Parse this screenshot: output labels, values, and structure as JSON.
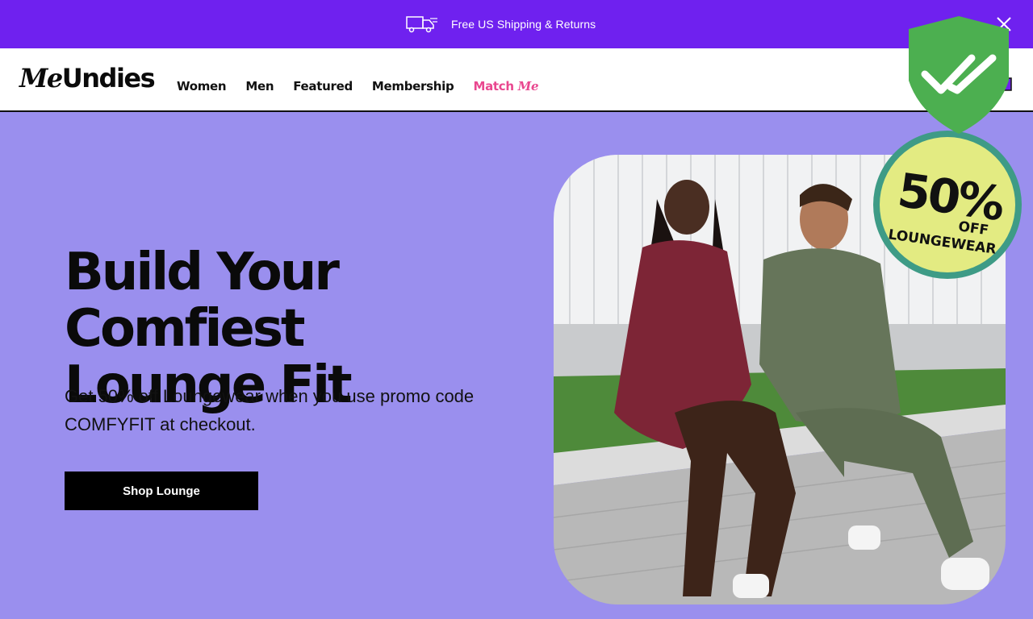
{
  "promo": {
    "text": "Free US Shipping & Returns",
    "truck_icon": "truck-icon",
    "close_icon": "close-icon"
  },
  "header": {
    "logo_me": "Me",
    "logo_rest": "Undies",
    "nav": [
      {
        "label": "Women"
      },
      {
        "label": "Men"
      },
      {
        "label": "Featured"
      },
      {
        "label": "Membership"
      }
    ],
    "match_label_a": "Match ",
    "match_label_b": "Me",
    "cart_icon": "shopping-bag-icon"
  },
  "hero": {
    "title_line1": "Build Your Comfiest",
    "title_line2": "Lounge Fit",
    "subtitle": "Get 50% off Loungewear when you use promo code COMFYFIT at checkout.",
    "cta_label": "Shop Lounge",
    "image": "Two people in loungewear sitting on a concrete ledge laughing"
  },
  "badge": {
    "percent": "50%",
    "off": "OFF",
    "label": "LOUNGEWEAR"
  },
  "colors": {
    "promo_bar": "#6f21ef",
    "hero_bg": "#9a8fee",
    "match_me": "#e9478f",
    "badge_fill": "#e3eb82",
    "badge_ring": "#3e9b86",
    "shield_green": "#4caf50"
  }
}
